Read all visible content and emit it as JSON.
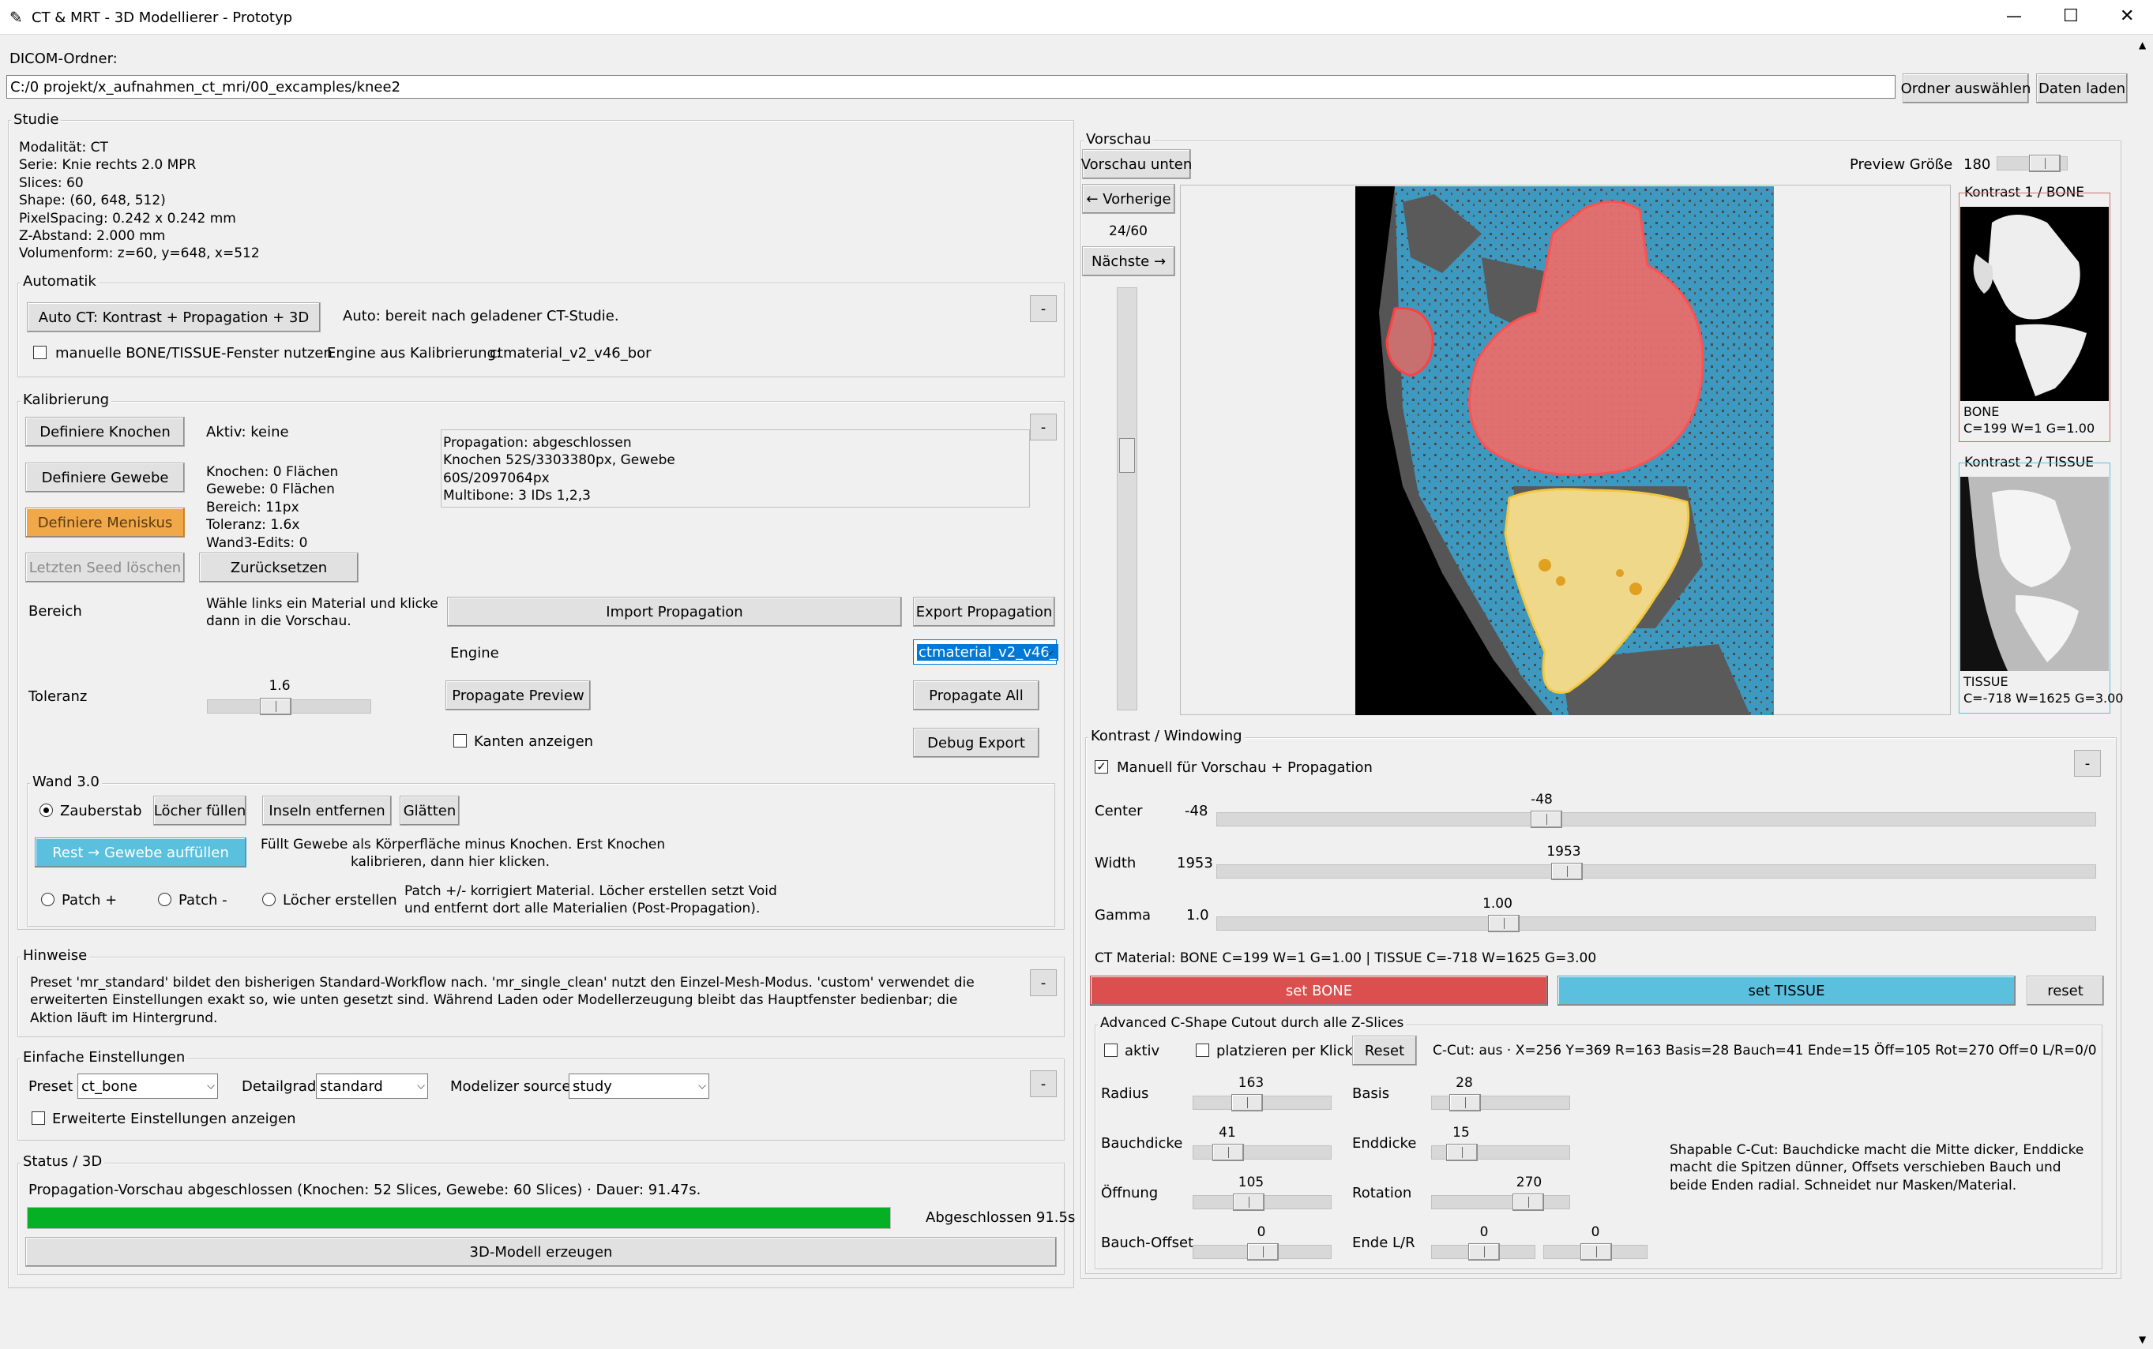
{
  "window": {
    "title": "CT & MRT - 3D Modellierer - Prototyp",
    "min": "—",
    "max": "☐",
    "close": "✕"
  },
  "dicom": {
    "label": "DICOM-Ordner:",
    "path": "C:/0 projekt/x_aufnahmen_ct_mri/00_excamples/knee2",
    "choose": "Ordner auswählen",
    "load": "Daten laden"
  },
  "studie": {
    "title": "Studie",
    "lines": [
      "Modalität: CT",
      "Serie: Knie rechts  2.0  MPR",
      "Slices: 60",
      "Shape: (60, 648, 512)",
      "PixelSpacing: 0.242 x 0.242 mm",
      "Z-Abstand: 2.000 mm",
      "Volumenform: z=60, y=648, x=512"
    ]
  },
  "auto": {
    "title": "Automatik",
    "button": "Auto CT: Kontrast + Propagation + 3D",
    "status": "Auto: bereit nach geladener CT-Studie.",
    "manual": "manuelle BONE/TISSUE-Fenster nutzen",
    "engine_label": "Engine aus Kalibrierung:",
    "engine_value": "ctmaterial_v2_v46_bor",
    "collapse": "-"
  },
  "kal": {
    "title": "Kalibrierung",
    "btn_knochen": "Definiere Knochen",
    "btn_gewebe": "Definiere Gewebe",
    "btn_meniskus": "Definiere Meniskus",
    "btn_seed": "Letzten Seed löschen",
    "btn_reset": "Zurücksetzen",
    "aktiv": "Aktiv: keine",
    "stats": [
      "Knochen: 0 Flächen",
      "Gewebe: 0 Flächen",
      "Bereich: 11px",
      "Toleranz: 1.6x",
      "Wand3-Edits: 0"
    ],
    "log": [
      "Propagation: abgeschlossen",
      "Knochen 52S/3303380px, Gewebe",
      "60S/2097064px",
      "Multibone: 3 IDs 1,2,3"
    ],
    "bereich_label": "Bereich",
    "bereich_hint": [
      "Wähle links ein Material und klicke",
      "dann in die Vorschau."
    ],
    "import": "Import Propagation",
    "export": "Export Propagation",
    "engine_label": "Engine",
    "engine_value": "ctmaterial_v2_v46_",
    "toleranz_label": "Toleranz",
    "toleranz_value": "1.6",
    "toleranz_pct": 0.42,
    "prop_preview": "Propagate Preview",
    "prop_all": "Propagate All",
    "kanten": "Kanten anzeigen",
    "debug": "Debug Export",
    "collapse": "-"
  },
  "wand": {
    "title": "Wand 3.0",
    "zauberstab": "Zauberstab",
    "fill_holes": "Löcher füllen",
    "remove_islands": "Inseln entfernen",
    "smooth": "Glätten",
    "rest": "Rest → Gewebe auffüllen",
    "rest_hint": [
      "Füllt Gewebe als Körperfläche minus Knochen. Erst Knochen",
      "kalibrieren, dann hier klicken."
    ],
    "patch_plus": "Patch +",
    "patch_minus": "Patch -",
    "holes": "Löcher erstellen",
    "patch_hint": [
      "Patch +/- korrigiert Material. Löcher erstellen setzt Void",
      "und entfernt dort alle Materialien (Post-Propagation)."
    ]
  },
  "hinweise": {
    "title": "Hinweise",
    "lines": [
      "Preset 'mr_standard' bildet den bisherigen Standard-Workflow nach. 'mr_single_clean' nutzt den Einzel-Mesh-Modus. 'custom' verwendet die",
      "erweiterten Einstellungen exakt so, wie unten gesetzt sind. Während Laden oder Modellerzeugung bleibt das Hauptfenster bedienbar; die",
      "Aktion läuft im Hintergrund."
    ],
    "collapse": "-"
  },
  "einfach": {
    "title": "Einfache Einstellungen",
    "preset_label": "Preset",
    "preset": "ct_bone",
    "detail_label": "Detailgrad",
    "detail": "standard",
    "source_label": "Modelizer source",
    "source": "study",
    "erweitert": "Erweiterte Einstellungen anzeigen",
    "collapse": "-"
  },
  "status": {
    "title": "Status / 3D",
    "text": "Propagation-Vorschau abgeschlossen (Knochen: 52 Slices, Gewebe: 60 Slices) · Dauer: 91.47s.",
    "progress": 1.0,
    "done": "Abgeschlossen 91.5s",
    "model": "3D-Modell erzeugen"
  },
  "vorschau": {
    "title": "Vorschau",
    "unten": "Vorschau unten",
    "prev": "← Vorherige",
    "index": "24/60",
    "next": "Nächste →",
    "size_label": "Preview Größe",
    "size": "180",
    "slice_pos": 0.4
  },
  "k1": {
    "title": "Kontrast 1 / BONE",
    "label": "BONE",
    "values": "C=199 W=1 G=1.00"
  },
  "k2": {
    "title": "Kontrast 2 / TISSUE",
    "label": "TISSUE",
    "values": "C=-718 W=1625 G=3.00"
  },
  "win": {
    "title": "Kontrast / Windowing",
    "manual": "Manuell für Vorschau + Propagation",
    "collapse": "-",
    "center_label": "Center",
    "center": "-48",
    "center_pct": 0.37,
    "width_label": "Width",
    "width": "1953",
    "width_pct": 0.395,
    "gamma_label": "Gamma",
    "gamma": "1.0",
    "gamma_val": "1.00",
    "gamma_pct": 0.32,
    "material": "CT Material: BONE C=199 W=1 G=1.00 | TISSUE C=-718 W=1625 G=3.00",
    "set_bone": "set BONE",
    "set_tissue": "set TISSUE",
    "reset": "reset",
    "bone_color": "#db4f4f",
    "tissue_color": "#5bc0de"
  },
  "cshape": {
    "title": "Advanced C-Shape Cutout durch alle Z-Slices",
    "aktiv": "aktiv",
    "platz": "platzieren per Klick",
    "reset": "Reset",
    "status": "C-Cut: aus · X=256 Y=369 R=163 Basis=28 Bauch=41 Ende=15 Öff=105 Rot=270 Off=0 L/R=0/0",
    "radius_label": "Radius",
    "radius": "163",
    "basis_label": "Basis",
    "basis": "28",
    "bauch_label": "Bauchdicke",
    "bauch": "41",
    "end_label": "Enddicke",
    "end": "15",
    "offnung_label": "Öffnung",
    "offnung": "105",
    "rot_label": "Rotation",
    "rot": "270",
    "boffset_label": "Bauch-Offset",
    "boffset": "0",
    "endelr_label": "Ende L/R",
    "endel": "0",
    "ender": "0",
    "hint": [
      "Shapable C-Cut: Bauchdicke macht die Mitte dicker, Enddicke",
      "macht die Spitzen dünner, Offsets verschieben Bauch und",
      "beide Enden radial. Schneidet nur Masken/Material."
    ]
  }
}
